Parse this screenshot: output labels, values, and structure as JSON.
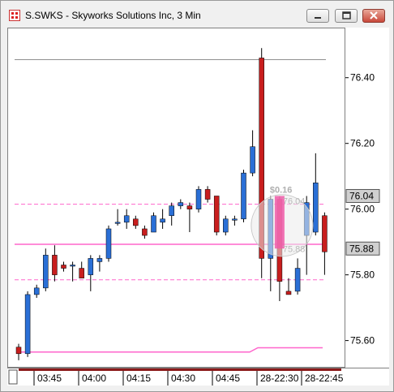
{
  "window": {
    "title": "S.SWKS - Skyworks Solutions Inc, 3 Min",
    "minimize_label": "minimize",
    "restore_label": "restore",
    "close_label": "close"
  },
  "colors": {
    "up": "#2a6fd6",
    "down": "#c81e1e",
    "level_line": "#ff66cc",
    "top_line": "#909090",
    "price_box_bg": "#d0d0d0"
  },
  "chart_data": {
    "type": "candlestick",
    "ylim": [
      75.52,
      76.55
    ],
    "y_ticks": [
      "76.40",
      "76.20",
      "76.00",
      "75.80",
      "75.60"
    ],
    "x_ticks": [
      "03:45",
      "04:00",
      "04:15",
      "04:30",
      "04:45",
      "28-22:30",
      "28-22:45"
    ],
    "price_markers": [
      {
        "label": "76.04",
        "value": 76.04
      },
      {
        "label": "75.88",
        "value": 75.88
      }
    ],
    "overlay_labels": {
      "change": "$0.16",
      "upper_price": "76.04",
      "lower_price": "75.88"
    },
    "candles": [
      {
        "o": 75.58,
        "h": 75.59,
        "l": 75.54,
        "c": 75.56
      },
      {
        "o": 75.56,
        "h": 75.75,
        "l": 75.55,
        "c": 75.74
      },
      {
        "o": 75.74,
        "h": 75.77,
        "l": 75.73,
        "c": 75.76
      },
      {
        "o": 75.76,
        "h": 75.88,
        "l": 75.75,
        "c": 75.86
      },
      {
        "o": 75.86,
        "h": 75.89,
        "l": 75.78,
        "c": 75.8
      },
      {
        "o": 75.83,
        "h": 75.84,
        "l": 75.81,
        "c": 75.82
      },
      {
        "o": 75.83,
        "h": 75.84,
        "l": 75.78,
        "c": 75.83
      },
      {
        "o": 75.82,
        "h": 75.84,
        "l": 75.79,
        "c": 75.79
      },
      {
        "o": 75.8,
        "h": 75.86,
        "l": 75.75,
        "c": 75.85
      },
      {
        "o": 75.84,
        "h": 75.86,
        "l": 75.81,
        "c": 75.85
      },
      {
        "o": 75.85,
        "h": 75.95,
        "l": 75.84,
        "c": 75.94
      },
      {
        "o": 75.96,
        "h": 76.0,
        "l": 75.95,
        "c": 75.96
      },
      {
        "o": 75.96,
        "h": 76.0,
        "l": 75.94,
        "c": 75.98
      },
      {
        "o": 75.97,
        "h": 75.98,
        "l": 75.94,
        "c": 75.95
      },
      {
        "o": 75.94,
        "h": 75.95,
        "l": 75.91,
        "c": 75.92
      },
      {
        "o": 75.93,
        "h": 75.99,
        "l": 75.93,
        "c": 75.98
      },
      {
        "o": 75.96,
        "h": 76.0,
        "l": 75.94,
        "c": 75.97
      },
      {
        "o": 75.98,
        "h": 76.02,
        "l": 75.95,
        "c": 76.01
      },
      {
        "o": 76.01,
        "h": 76.03,
        "l": 76.0,
        "c": 76.02
      },
      {
        "o": 76.01,
        "h": 76.02,
        "l": 75.93,
        "c": 76.0
      },
      {
        "o": 76.0,
        "h": 76.07,
        "l": 75.99,
        "c": 76.06
      },
      {
        "o": 76.06,
        "h": 76.07,
        "l": 76.02,
        "c": 76.03
      },
      {
        "o": 76.04,
        "h": 76.04,
        "l": 75.92,
        "c": 75.93
      },
      {
        "o": 75.93,
        "h": 75.98,
        "l": 75.92,
        "c": 75.97
      },
      {
        "o": 75.97,
        "h": 75.98,
        "l": 75.95,
        "c": 75.97
      },
      {
        "o": 75.97,
        "h": 76.12,
        "l": 75.96,
        "c": 76.11
      },
      {
        "o": 76.11,
        "h": 76.24,
        "l": 76.1,
        "c": 76.19
      },
      {
        "o": 76.46,
        "h": 76.49,
        "l": 75.79,
        "c": 75.85
      },
      {
        "o": 75.85,
        "h": 76.04,
        "l": 75.75,
        "c": 76.03
      },
      {
        "o": 76.03,
        "h": 76.04,
        "l": 75.72,
        "c": 75.78
      },
      {
        "o": 75.75,
        "h": 75.79,
        "l": 75.74,
        "c": 75.74
      },
      {
        "o": 75.75,
        "h": 75.85,
        "l": 75.74,
        "c": 75.82
      },
      {
        "o": 75.92,
        "h": 76.04,
        "l": 75.8,
        "c": 76.02
      },
      {
        "o": 75.93,
        "h": 76.17,
        "l": 75.92,
        "c": 76.08
      },
      {
        "o": 75.98,
        "h": 75.99,
        "l": 75.8,
        "c": 75.87
      }
    ],
    "level_lines": [
      {
        "value": 76.015,
        "style": "dashed",
        "x_from": 0.0,
        "x_to": 1.0
      },
      {
        "value": 75.893,
        "style": "solid",
        "x_from": 0.0,
        "x_to": 1.0
      },
      {
        "value": 75.785,
        "style": "dashed",
        "x_from": 0.0,
        "x_to": 1.0
      }
    ],
    "top_line": {
      "value": 76.455
    },
    "stepped_line": {
      "before": 75.565,
      "after": 75.578
    }
  }
}
